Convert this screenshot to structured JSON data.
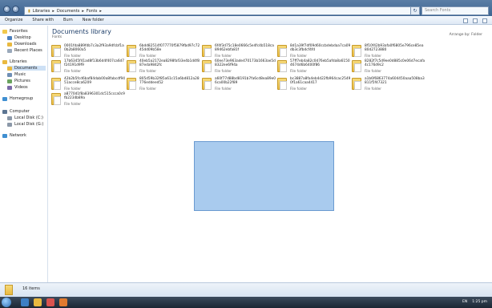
{
  "address": {
    "crumbs": [
      "Libraries",
      "Documents",
      "Fonts"
    ],
    "search_placeholder": "Search Fonts"
  },
  "toolbar": {
    "organize": "Organize",
    "share": "Share with",
    "burn": "Burn",
    "new_folder": "New folder"
  },
  "nav": {
    "favorites": "Favorites",
    "desktop": "Desktop",
    "downloads": "Downloads",
    "recent": "Recent Places",
    "libraries": "Libraries",
    "documents": "Documents",
    "music": "Music",
    "pictures": "Pictures",
    "videos": "Videos",
    "homegroup": "Homegroup",
    "computer": "Computer",
    "disk_c": "Local Disk (C:)",
    "disk_g": "Local Disk (G:)",
    "network": "Network"
  },
  "library": {
    "title": "Documents library",
    "subtitle": "Fonts",
    "arrange_label": "Arrange by:",
    "arrange_value": "Folder"
  },
  "files": [
    {
      "name": "0001fda889fdb7c3a2f93a9dfcbf1a0b2b8060a5",
      "type": "File folder"
    },
    {
      "name": "6bdd82514f077770f5879fbd97c7245dd09b58e",
      "type": "File folder"
    },
    {
      "name": "6f4f3d75c18e0666c5e4fc4b518ca89462ebfa81f",
      "type": "File folder"
    },
    {
      "name": "8d1a39f7df09d60ccbdebdaa7ca09db3c3fbdcf4fd",
      "type": "File folder"
    },
    {
      "name": "8f10f42b93afa0f6805e796ce85ea80d2723880",
      "type": "File folder"
    },
    {
      "name": "17b6345f41ad8f13b6d4f407ca6d7f24191d9f9",
      "type": "File folder"
    },
    {
      "name": "40eb5a2172ea8298faf33e4b1d4f887eda9842fc",
      "type": "File folder"
    },
    {
      "name": "60ee73e963ade470173b1663ae5d8322ee6f94a",
      "type": "File folder"
    },
    {
      "name": "57ff7eb4a82c0d76eb5afda8a61504674d6b6400f86",
      "type": "File folder"
    },
    {
      "name": "8282f7c5d9ee0d885c0e06d7ecafa4c176d9c2",
      "type": "File folder"
    },
    {
      "name": "42b2b5fcd6baf84dab00a8fabcdf9451acce8ca6209",
      "type": "File folder"
    },
    {
      "name": "805d59b32f85a61c15a6bd812a28776eddeed52",
      "type": "File folder"
    },
    {
      "name": "a60f77d88bd8191b7fa6cd8ea89e06ca00b22f89",
      "type": "File folder"
    },
    {
      "name": "bc3887a8fa4eb4d22fb964cac25490f1a61caa4417",
      "type": "File folder"
    },
    {
      "name": "a1b6f6863774a604450aaa508ba3811f5f47321",
      "type": "File folder"
    },
    {
      "name": "a8770d1f8a8396301dc515ccca0c9fb2234b89a",
      "type": "File folder"
    }
  ],
  "status": {
    "count": "16 items"
  },
  "taskbar": {
    "lang": "EN",
    "time": "1:25 pm"
  }
}
